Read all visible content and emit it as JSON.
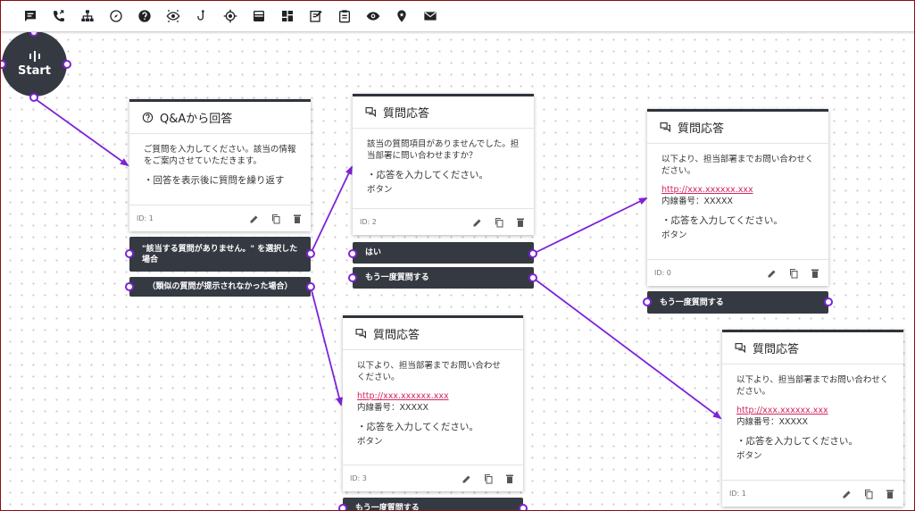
{
  "toolbar": {
    "tools": [
      "message-icon",
      "phone-forward-icon",
      "sitemap-icon",
      "compass-icon",
      "help-icon",
      "eye-scan-icon",
      "hook-icon",
      "crosshair-icon",
      "inbox-icon",
      "dashboard-icon",
      "note-edit-icon",
      "clipboard-icon",
      "eye-icon",
      "place-icon",
      "mail-icon"
    ]
  },
  "start": {
    "label": "Start"
  },
  "cards": [
    {
      "title": "Q&Aから回答",
      "body1": "ご質問を入力してください。該当の情報をご案内させていただきます。",
      "bullet": "・回答を表示後に質問を繰り返す",
      "id": "ID: 1"
    },
    {
      "title": "質問応答",
      "body1": "該当の質問項目がありませんでした。担当部署に問い合わせますか？",
      "bullet": "・応答を入力してください。",
      "sub": "ボタン",
      "id": "ID: 2"
    },
    {
      "title": "質問応答",
      "body1": "以下より、担当部署までお問い合わせください。",
      "link": "http://xxx.xxxxxx.xxx",
      "ext": "内線番号：XXXXX",
      "bullet": "・応答を入力してください。",
      "sub": "ボタン",
      "id": "ID: 0"
    },
    {
      "title": "質問応答",
      "body1": "以下より、担当部署までお問い合わせください。",
      "link": "http://xxx.xxxxxx.xxx",
      "ext": "内線番号：XXXXX",
      "bullet": "・応答を入力してください。",
      "sub": "ボタン",
      "id": "ID: 3"
    },
    {
      "title": "質問応答",
      "body1": "以下より、担当部署までお問い合わせください。",
      "link": "http://xxx.xxxxxx.xxx",
      "ext": "内線番号：XXXXX",
      "bullet": "・応答を入力してください。",
      "sub": "ボタン",
      "id": "ID: 1"
    }
  ],
  "bars": {
    "b1": "\"該当する質問がありません。\" を選択した場合",
    "b2": "（類似の質問が提示されなかった場合）",
    "b3": "はい",
    "b4": "もう一度質問する",
    "b5": "もう一度質問する",
    "b6": "もう一度質問する"
  },
  "colors": {
    "edge": "#7e22d8",
    "node": "#353a42",
    "frame": "#8a0f0f"
  }
}
